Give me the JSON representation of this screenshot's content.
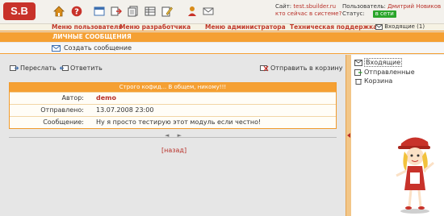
{
  "header": {
    "logo": "S.B",
    "site_label": "Сайт:",
    "site_value": "test.sbuilder.ru",
    "who_online": "кто сейчас в системе?",
    "user_label": "Пользователь:",
    "user_value": "Дмитрий Новиков",
    "status_label": "Статус:",
    "status_value": "в сети"
  },
  "menu": {
    "items": [
      {
        "label": "Меню пользователя"
      },
      {
        "label": "Меню разработчика"
      },
      {
        "label": "Меню администратора"
      },
      {
        "label": "Техническая поддержка"
      }
    ],
    "inbox": "Входящие (1)"
  },
  "section": {
    "title": "ЛИЧНЫЕ СООБЩЕНИЯ",
    "create": "Создать сообщение"
  },
  "actions": {
    "forward": "Переслать",
    "reply": "Ответить",
    "trash": "Отправить в корзину"
  },
  "message": {
    "subject": "Строго кофид... В общем, никому!!!",
    "author_label": "Автор:",
    "author": "demo",
    "sent_label": "Отправлено:",
    "sent": "13.07.2008 23:00",
    "body_label": "Сообщение:",
    "body": "Ну я просто тестирую этот модуль если честно!"
  },
  "pager": {
    "prev": "◄",
    "next": "►"
  },
  "back": "[назад]",
  "sidebar": {
    "items": [
      {
        "label": "Входящие",
        "icon": "inbox-icon"
      },
      {
        "label": "Отправленные",
        "icon": "sent-icon"
      },
      {
        "label": "Корзина",
        "icon": "trash-icon"
      }
    ]
  }
}
